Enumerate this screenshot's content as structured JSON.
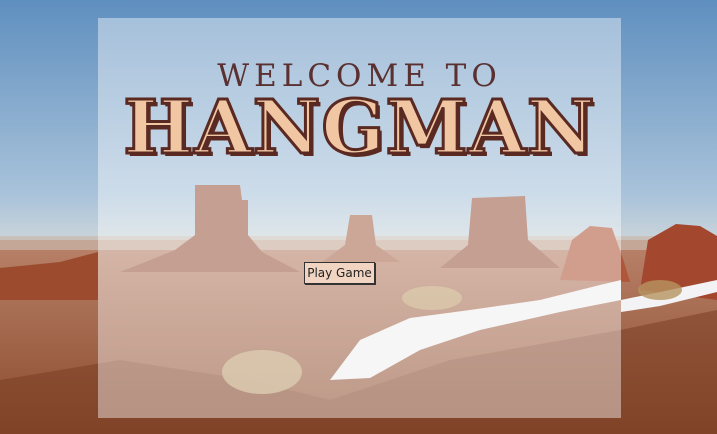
{
  "screen": {
    "welcome_text": "WELCOME TO",
    "title_text": "HANGMAN",
    "play_button_label": "Play Game"
  },
  "colors": {
    "title_fill": "#f1c6a3",
    "title_outline": "#5a2a22",
    "welcome_color": "#5a3030",
    "button_bg": "#f1d5c2"
  }
}
